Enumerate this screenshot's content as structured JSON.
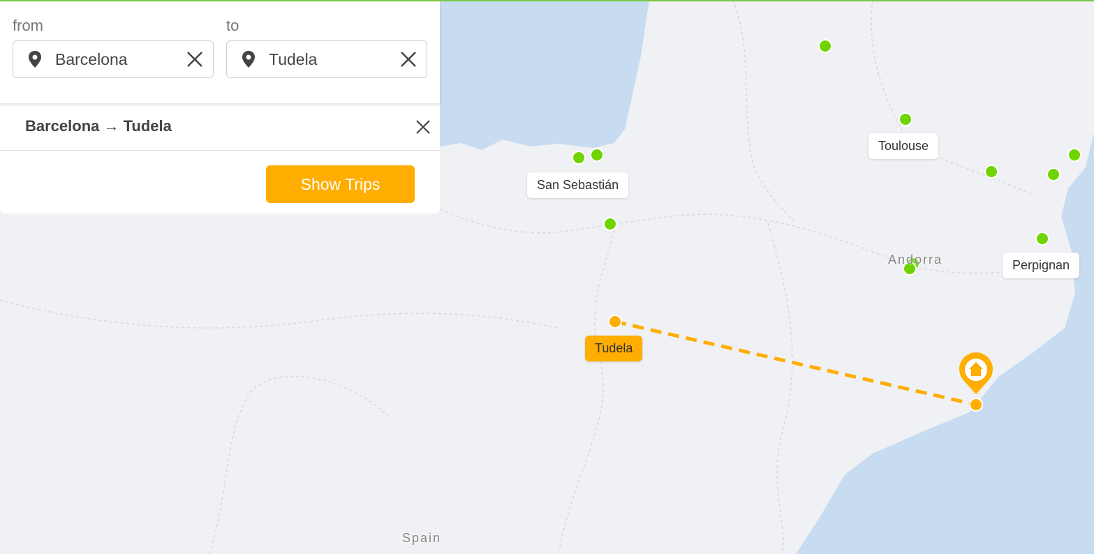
{
  "search": {
    "from_label": "from",
    "to_label": "to",
    "from_value": "Barcelona",
    "to_value": "Tudela"
  },
  "route": {
    "title": "Barcelona → Tudela",
    "button": "Show Trips"
  },
  "map": {
    "cities": [
      "San Sebastián",
      "Toulouse",
      "Perpignan",
      "Tudela"
    ],
    "region_labels": [
      "Andorra",
      "Spain"
    ],
    "colors": {
      "accent": "#ffad00",
      "marker": "#6fd400",
      "sea": "#c7dcf1",
      "land": "#f0f1f4"
    }
  }
}
